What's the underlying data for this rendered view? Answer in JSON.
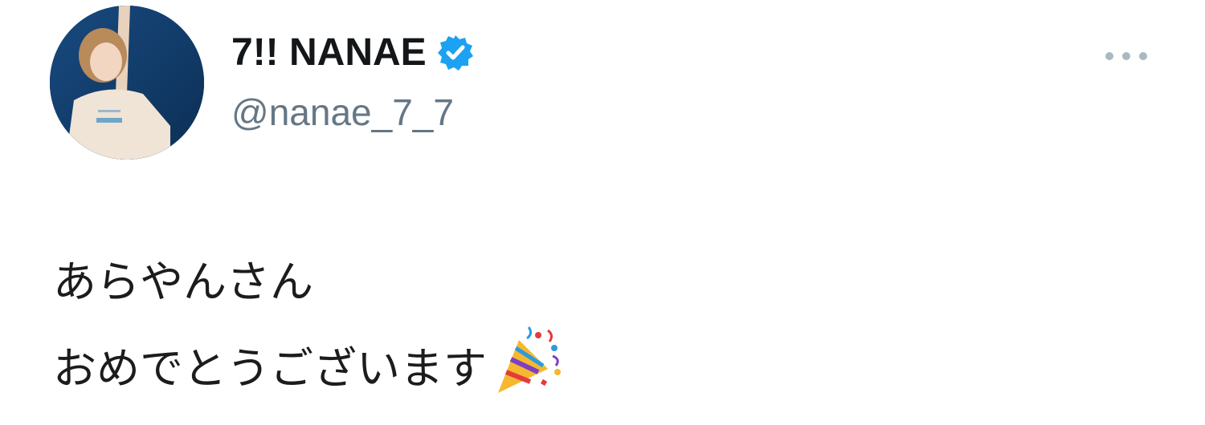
{
  "tweet": {
    "author": {
      "display_name": "7!! NANAE",
      "handle": "@nanae_7_7",
      "verified": true,
      "avatar_icon": "profile-photo"
    },
    "more_icon": "more-options-icon",
    "text_lines": [
      "あらやんさん",
      "おめでとうございます"
    ],
    "emoji": "party-popper-emoji"
  },
  "colors": {
    "verified_blue": "#1da1f2",
    "handle_gray": "#657786",
    "text": "#14171a"
  }
}
